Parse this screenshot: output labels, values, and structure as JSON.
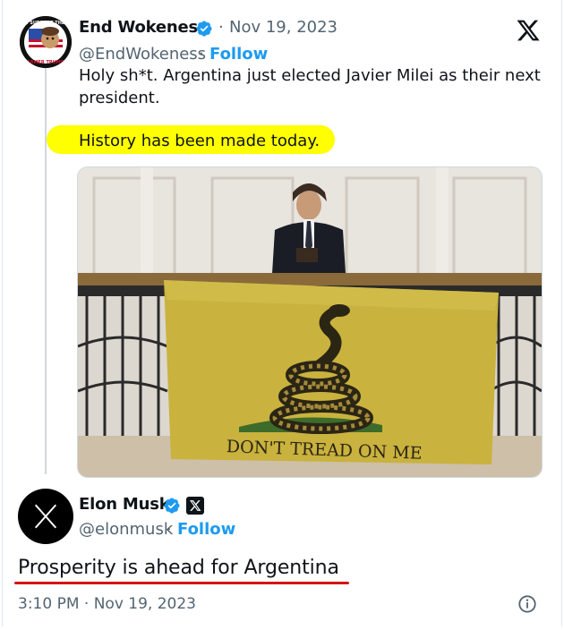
{
  "tweet": {
    "author_name": "End Wokeness",
    "date": "Nov 19, 2023",
    "handle": "@EndWokeness",
    "separator": "·",
    "follow_label": "Follow",
    "text_line1": "Holy sh*t. Argentina just elected Javier Milei as their next",
    "text_line2": "president.",
    "highlight_text": "History has been made today.",
    "avatar_text_top": "I SUPPORT THE",
    "avatar_text_bottom": "FARMER TRUMPS"
  },
  "image": {
    "flag_text": "DON'T TREAD ON ME",
    "colors": {
      "flag": "#c9b23e",
      "wall": "#e6e2dc",
      "railing": "#2a2a2a"
    }
  },
  "reply": {
    "author_name": "Elon Musk",
    "handle": "@elonmusk",
    "separator": "·",
    "follow_label": "Follow",
    "text": "Prosperity is ahead for Argentina",
    "timestamp": "3:10 PM · Nov 19, 2023"
  },
  "icons": [
    "x-logo-icon",
    "verified-badge-icon",
    "info-icon",
    "x-affiliate-badge-icon"
  ],
  "colors": {
    "accent": "#1d9bf0",
    "highlight": "#ffff00",
    "underline": "#d01616",
    "muted": "#536471"
  }
}
